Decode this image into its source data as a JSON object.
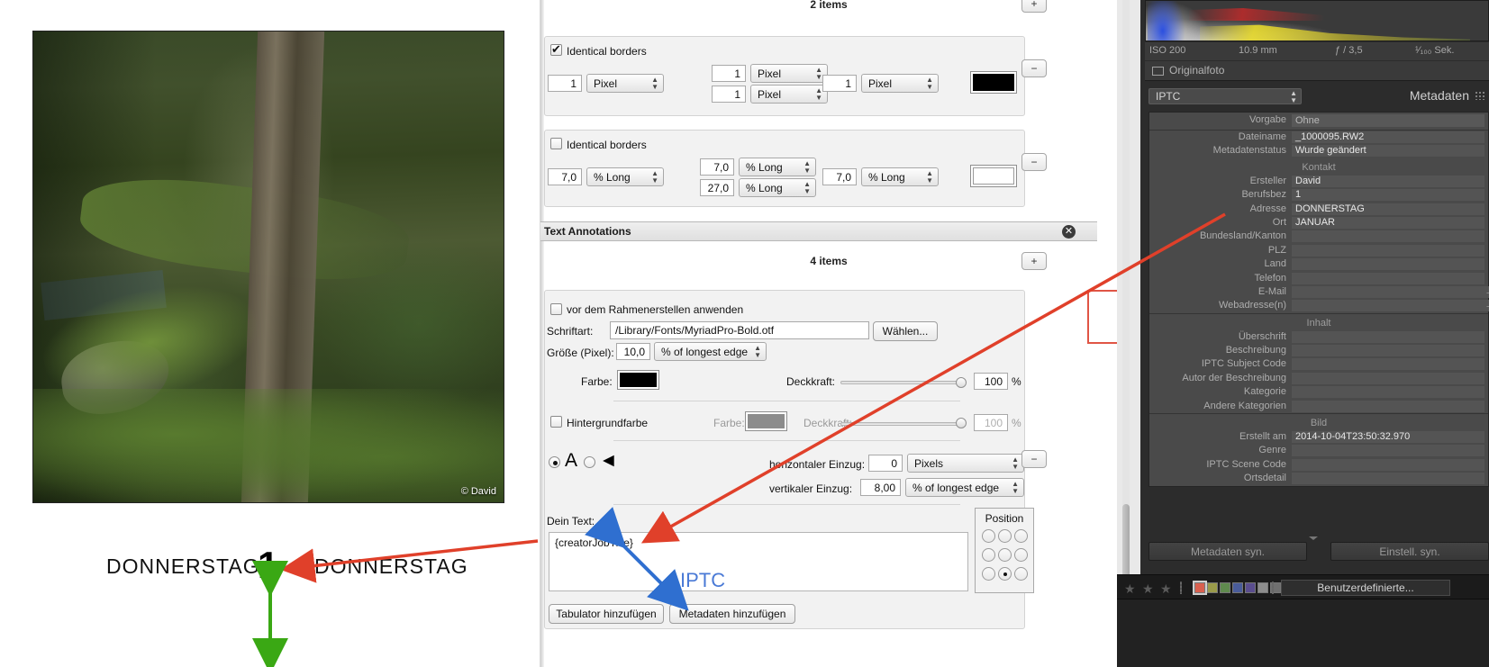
{
  "left_preview": {
    "photo_credit": "© David",
    "caption_left": "DONNERSTAG",
    "caption_number": "1",
    "caption_right": "DONNERSTAG"
  },
  "borders_panel": {
    "items_count": "2 items",
    "add_button": "+",
    "remove_button": "−",
    "group1": {
      "identical_label": "Identical borders",
      "identical_checked": true,
      "left_value": "1",
      "left_unit": "Pixel",
      "top_value": "1",
      "top_unit": "Pixel",
      "bottom_value": "1",
      "bottom_unit": "Pixel",
      "right_value": "1",
      "right_unit": "Pixel",
      "color_hex": "#000000"
    },
    "group2": {
      "identical_label": "Identical borders",
      "identical_checked": false,
      "left_value": "7,0",
      "left_unit": "% Long",
      "top_value": "7,0",
      "top_unit": "% Long",
      "bottom_value": "27,0",
      "bottom_unit": "% Long",
      "right_value": "7,0",
      "right_unit": "% Long",
      "color_hex": "#ffffff"
    }
  },
  "text_annotations": {
    "section_title": "Text Annotations",
    "close_icon": "✕",
    "items_count": "4 items",
    "add_button": "+",
    "remove_button": "−",
    "apply_before_frame": {
      "label": "vor dem Rahmenerstellen anwenden",
      "checked": false
    },
    "font": {
      "label": "Schriftart:",
      "value": "/Library/Fonts/MyriadPro-Bold.otf",
      "choose_button": "Wählen..."
    },
    "size": {
      "label": "Größe (Pixel):",
      "value": "10,0",
      "unit": "% of longest edge"
    },
    "color": {
      "label": "Farbe:",
      "hex": "#000000"
    },
    "opacity": {
      "label": "Deckkraft:",
      "value": "100",
      "suffix": "%"
    },
    "background": {
      "checkbox_label": "Hintergrundfarbe",
      "checked": false,
      "color_label": "Farbe:",
      "hex": "#8c8c8c",
      "opacity_label": "Deckkraft:",
      "opacity_value": "100",
      "opacity_suffix": "%"
    },
    "mode": {
      "text_mode_selected": true,
      "text_mode_glyph": "A",
      "shape_mode_glyph": "◄",
      "shape_mode_selected": false
    },
    "horizontal_inset": {
      "label": "horizontaler Einzug:",
      "value": "0",
      "unit": "Pixels"
    },
    "vertical_inset": {
      "label": "vertikaler Einzug:",
      "value": "8,00",
      "unit": "% of longest edge"
    },
    "your_text": {
      "label": "Dein Text:",
      "value": "{creatorJobTitle}"
    },
    "buttons": {
      "add_tab": "Tabulator hinzufügen",
      "add_metadata": "Metadaten hinzufügen"
    },
    "position": {
      "title": "Position",
      "selected_index": 7
    },
    "annotation_note": "IPTC"
  },
  "lightroom": {
    "exif": {
      "iso": "ISO 200",
      "focal": "10.9 mm",
      "aperture": "ƒ / 3,5",
      "shutter": "¹⁄₁₀₀ Sek."
    },
    "original_photo_label": "Originalfoto",
    "metadata_header": {
      "preset_select": "IPTC",
      "title": "Metadaten"
    },
    "preset_row": {
      "key": "Vorgabe",
      "value": "Ohne"
    },
    "file_rows": [
      {
        "key": "Dateiname",
        "value": "_1000095.RW2"
      },
      {
        "key": "Metadatenstatus",
        "value": "Wurde geändert"
      }
    ],
    "contact_group": "Kontakt",
    "contact_rows": [
      {
        "key": "Ersteller",
        "value": "David"
      },
      {
        "key": "Berufsbez",
        "value": "1"
      },
      {
        "key": "Adresse",
        "value": "DONNERSTAG"
      },
      {
        "key": "Ort",
        "value": "JANUAR"
      },
      {
        "key": "Bundesland/Kanton",
        "value": ""
      },
      {
        "key": "PLZ",
        "value": ""
      },
      {
        "key": "Land",
        "value": ""
      },
      {
        "key": "Telefon",
        "value": ""
      },
      {
        "key": "E-Mail",
        "value": "",
        "more": "→"
      },
      {
        "key": "Webadresse(n)",
        "value": "",
        "more": "→"
      }
    ],
    "content_group": "Inhalt",
    "content_rows": [
      {
        "key": "Überschrift",
        "value": ""
      },
      {
        "key": "Beschreibung",
        "value": ""
      },
      {
        "key": "IPTC Subject Code",
        "value": ""
      },
      {
        "key": "Autor der Beschreibung",
        "value": ""
      },
      {
        "key": "Kategorie",
        "value": ""
      },
      {
        "key": "Andere Kategorien",
        "value": ""
      }
    ],
    "image_group": "Bild",
    "image_rows": [
      {
        "key": "Erstellt am",
        "value": "2014-10-04T23:50:32.970"
      },
      {
        "key": "Genre",
        "value": ""
      },
      {
        "key": "IPTC Scene Code",
        "value": ""
      },
      {
        "key": "Ortsdetail",
        "value": ""
      }
    ],
    "sync_buttons": {
      "metadata": "Metadaten syn.",
      "settings": "Einstell. syn."
    },
    "filmstrip": {
      "stars": "★★★",
      "color_labels": [
        "#d9604f",
        "#9a9b4a",
        "#5f8a4e",
        "#4a5c9a",
        "#5a4d8e",
        "#8d8d8d",
        "#6f6f6f"
      ],
      "selected_color_index": 0,
      "custom_button": "Benutzerdefinierte..."
    }
  }
}
